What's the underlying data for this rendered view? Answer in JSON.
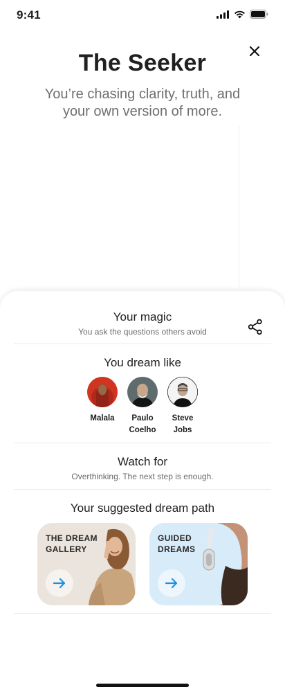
{
  "status": {
    "time": "9:41"
  },
  "hero": {
    "title": "The Seeker",
    "subtitle": "You’re chasing clarity, truth, and your own version of more."
  },
  "magic": {
    "title": "Your magic",
    "subtitle": "You ask the questions others avoid"
  },
  "dream_like": {
    "title": "You dream like",
    "people": [
      {
        "name": "Malala"
      },
      {
        "name": "Paulo Coelho"
      },
      {
        "name": "Steve Jobs"
      }
    ]
  },
  "watch": {
    "title": "Watch for",
    "subtitle": "Overthinking. The next step is enough."
  },
  "path": {
    "title": "Your suggested dream path",
    "cards": [
      {
        "label": "THE DREAM\nGALLERY"
      },
      {
        "label": "GUIDED\nDREAMS"
      }
    ]
  },
  "colors": {
    "accent": "#1e90e0",
    "card_gallery_bg": "#eae4dc",
    "card_dreams_bg": "#d7ebf8"
  },
  "icons": {
    "close": "close-icon",
    "share": "share-icon",
    "arrow": "arrow-right-icon",
    "signal": "signal-icon",
    "wifi": "wifi-icon",
    "battery": "battery-icon"
  }
}
